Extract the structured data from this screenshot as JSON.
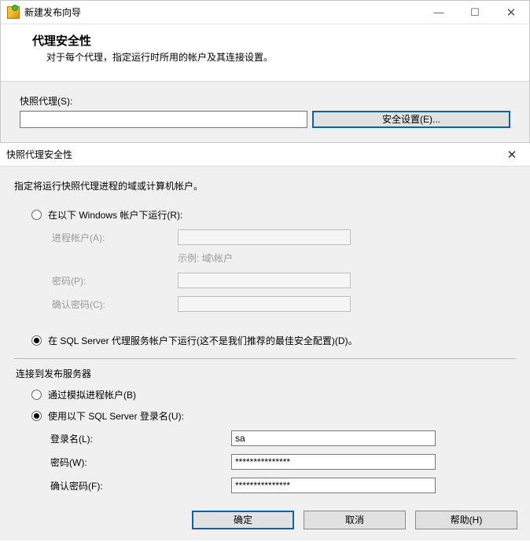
{
  "wizard": {
    "window_title": "新建发布向导",
    "header_title": "代理安全性",
    "header_sub": "对于每个代理，指定运行时所用的帐户及其连接设置。",
    "snapshot_label": "快照代理(S):",
    "snapshot_value": "",
    "security_button": "安全设置(E)..."
  },
  "dialog": {
    "title": "快照代理安全性",
    "instruction": "指定将运行快照代理进程的域或计算机帐户。",
    "run_as": {
      "windows_label": "在以下 Windows 帐户下运行(R):",
      "process_account_label": "进程帐户(A):",
      "process_account_hint": "示例: 域\\帐户",
      "password_label": "密码(P):",
      "confirm_password_label": "确认密码(C):",
      "sql_agent_label": "在 SQL Server 代理服务帐户下运行(这不是我们推荐的最佳安全配置)(D)。"
    },
    "connect": {
      "section_title": "连接到发布服务器",
      "impersonate_label": "通过模拟进程帐户(B)",
      "sql_login_label": "使用以下 SQL Server 登录名(U):",
      "login_label": "登录名(L):",
      "login_value": "sa",
      "password_label": "密码(W):",
      "password_value": "***************",
      "confirm_label": "确认密码(F):",
      "confirm_value": "***************"
    },
    "buttons": {
      "ok": "确定",
      "cancel": "取消",
      "help": "帮助(H)"
    }
  }
}
